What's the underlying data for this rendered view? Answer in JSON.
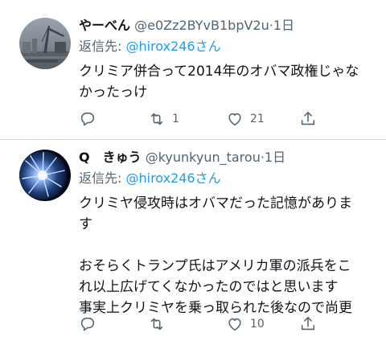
{
  "tweets": [
    {
      "display_name": "やーべん",
      "handle": "@e0Zz2BYvB1bpV2u",
      "separator": "·",
      "time": "1日",
      "reply_prefix": "返信先: ",
      "reply_to": "@hirox246さん",
      "text": "クリミア併合って2014年のオバマ政権じゃな\nかったっけ",
      "reply_count": "",
      "retweet_count": "1",
      "like_count": "21",
      "avatar_icon": "harbor-crane-photo"
    },
    {
      "display_name": "Q　きゅう",
      "handle": "@kyunkyun_tarou",
      "separator": "·",
      "time": "1日",
      "reply_prefix": "返信先: ",
      "reply_to": "@hirox246さん",
      "text": "クリミヤ侵攻時はオバマだった記憶がありま\nす\n\nおそらくトランプ氏はアメリカ軍の派兵をこ\nれ以上広げてくなかったのではと思います\n事実上クリミヤを乗っ取られた後なので尚更",
      "reply_count": "",
      "retweet_count": "",
      "like_count": "10",
      "avatar_icon": "blue-flower-photo"
    }
  ],
  "colors": {
    "text": "#0f1419",
    "secondary": "#536471",
    "link": "#1d9bf0",
    "divider": "#cfd9de"
  }
}
